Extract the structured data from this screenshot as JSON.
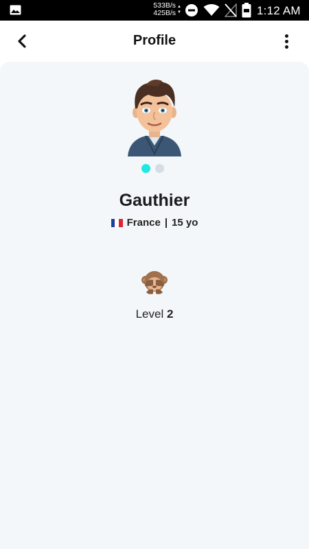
{
  "status_bar": {
    "speed_down": "533B/s",
    "speed_up": "425B/s",
    "time": "1:12 AM",
    "icons": [
      "gallery-icon",
      "data-arrows-icon",
      "do-not-disturb-icon",
      "wifi-icon",
      "signal-off-icon",
      "battery-icon"
    ]
  },
  "header": {
    "title": "Profile",
    "back_icon": "chevron-left-icon",
    "menu_icon": "more-vertical-icon"
  },
  "profile": {
    "name": "Gauthier",
    "country": "France",
    "separator": "|",
    "age": "15 yo",
    "avatar_icon": "bitmoji-avatar",
    "carousel": {
      "total": 2,
      "active_index": 0
    },
    "level_label": "Level",
    "level_value": "2",
    "level_icon": "see-no-evil-monkey-icon"
  },
  "colors": {
    "accent": "#1de9e0",
    "inactive_dot": "#d3dde3",
    "card_bg": "#f4f7f9"
  }
}
